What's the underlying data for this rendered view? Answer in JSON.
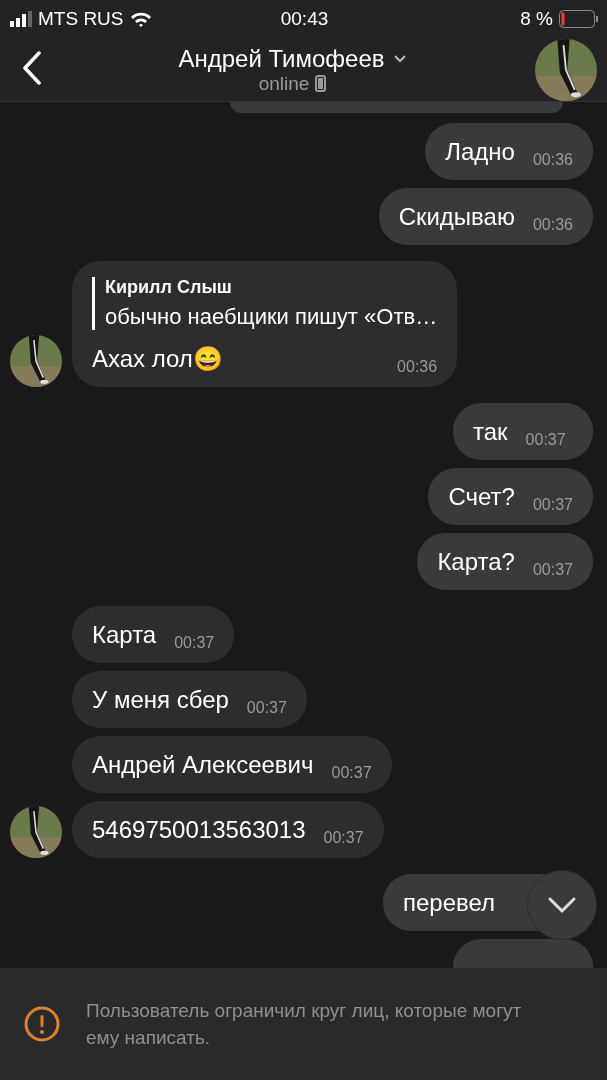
{
  "status_bar": {
    "carrier": "MTS RUS",
    "time": "00:43",
    "battery": "8 %"
  },
  "header": {
    "name": "Андрей Тимофеев",
    "status": "online"
  },
  "messages": [
    {
      "outgoing": true,
      "text": "Ладно",
      "time": "00:36"
    },
    {
      "outgoing": true,
      "text": "Скидываю",
      "time": "00:36"
    },
    {
      "outgoing": false,
      "reply": {
        "author": "Кирилл Слыш",
        "text": "обычно наебщики пишут «Отв…"
      },
      "text": "Ахах лол😄",
      "time": "00:36",
      "avatar": true
    },
    {
      "outgoing": true,
      "text": "так",
      "time": "00:37"
    },
    {
      "outgoing": true,
      "text": "Счет?",
      "time": "00:37"
    },
    {
      "outgoing": true,
      "text": "Карта?",
      "time": "00:37"
    },
    {
      "outgoing": false,
      "text": "Карта",
      "time": "00:37",
      "avatar": false
    },
    {
      "outgoing": false,
      "text": "У меня сбер",
      "time": "00:37",
      "avatar": false
    },
    {
      "outgoing": false,
      "text": "Андрей Алексеевич",
      "time": "00:37",
      "avatar": false
    },
    {
      "outgoing": false,
      "text": "5469750013563013",
      "time": "00:37",
      "avatar": true
    },
    {
      "outgoing": true,
      "text": "перевел"
    },
    {
      "outgoing": true
    }
  ],
  "notice": "Пользователь ограничил круг лиц, которые могут ему написать."
}
